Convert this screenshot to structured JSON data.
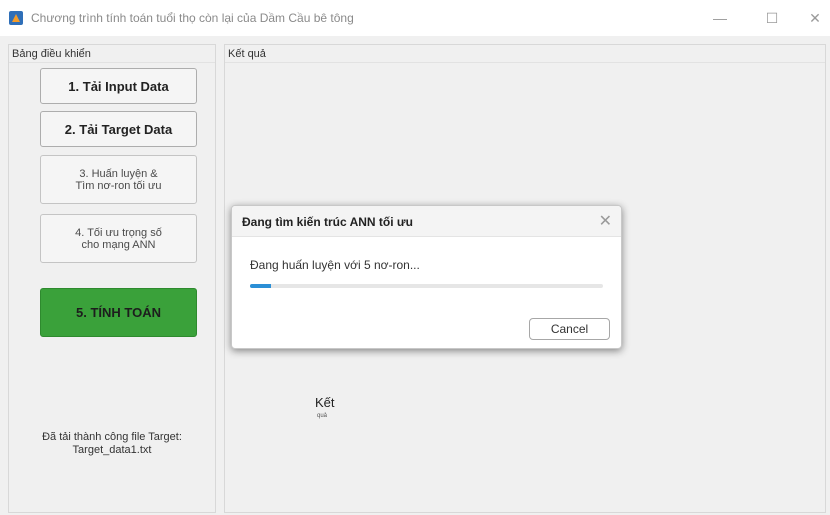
{
  "window": {
    "title": "Chương trình tính toán tuổi thọ còn lại của Dầm Cầu bê tông",
    "icon": "matlab-icon",
    "minimize": "—",
    "maximize": "☐",
    "close": "✕"
  },
  "left_panel": {
    "title": "Bảng điều khiển",
    "buttons": {
      "load_input": "1. Tải Input Data",
      "load_target": "2. Tải Target Data",
      "train_line1": "3. Huấn luyện &",
      "train_line2": "Tìm nơ-ron tối ưu",
      "optimize_line1": "4. Tối ưu trọng số",
      "optimize_line2": "cho mạng ANN",
      "compute": "5. TÍNH TOÁN"
    },
    "status_line1": "Đã tải thành công file Target:",
    "status_line2": "Target_data1.txt"
  },
  "right_panel": {
    "title": "Kết quả",
    "result_label": "Kết",
    "result_sub": "quả"
  },
  "dialog": {
    "title": "Đang tìm kiến trúc ANN tối ưu",
    "close": "✕",
    "message": "Đang huấn luyện với 5 nơ-ron...",
    "progress": 0.06,
    "cancel": "Cancel"
  },
  "colors": {
    "compute_button": "#3aa13a",
    "progress": "#2b8fd6"
  }
}
